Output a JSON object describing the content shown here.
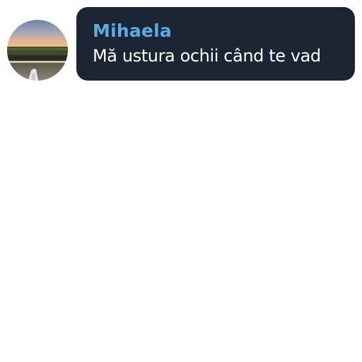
{
  "chat": {
    "message": {
      "sender": "Mihaela",
      "text": "Mă ustura ochii când te vad"
    }
  },
  "avatar": {
    "icon": "profile-photo-landscape"
  },
  "colors": {
    "bubble_background": "#1b2533",
    "sender_name": "#5aace4",
    "message_text": "#ffffff",
    "page_background": "#ffffff"
  }
}
